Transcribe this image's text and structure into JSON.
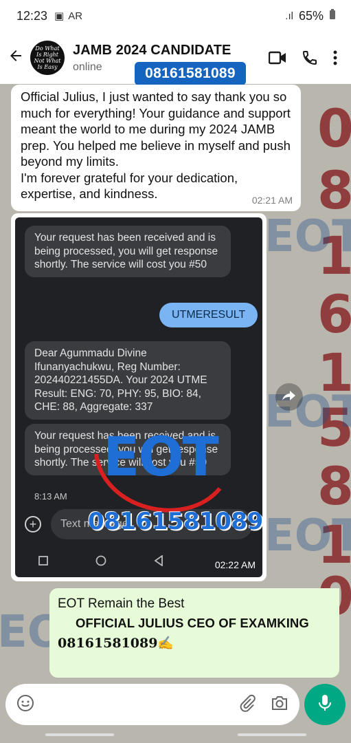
{
  "status_bar": {
    "time": "12:23",
    "battery": "65%"
  },
  "header": {
    "title": "JAMB 2024 CANDIDATE",
    "subtitle": "online",
    "avatar_text": "Do What Is Right Not What Is Easy"
  },
  "banner_phone": "08161581089",
  "messages": {
    "incoming": {
      "text": "Official Julius, I just wanted to say thank you so much for everything! Your guidance and support meant the world to me during my 2024 JAMB prep. You helped me believe in myself and push beyond my limits.\nI'm forever grateful for your dedication, expertise, and kindness.",
      "time": "02:21 AM"
    },
    "screenshot": {
      "sms1": "Your request has been received and is being processed, you will get response shortly. The service will cost you #50",
      "reply": "UTMERESULT",
      "sms2": "Dear Agummadu Divine Ifunanyachukwu, Reg Number: 202440221455DA. Your 2024 UTME Result: ENG: 70, PHY: 95, BIO: 84, CHE: 88, Aggregate: 337",
      "sms3": "Your request has been received and is being processed, you will get response shortly. The service will cost you #50",
      "sms3_time": "8:13 AM",
      "input_placeholder": "Text message",
      "time": "02:22 AM"
    },
    "watermark": {
      "brand": "EOT",
      "phone": "08161581089"
    },
    "outgoing": {
      "line1": "EOT  Remain the Best",
      "line2": "OFFICIAL JULIUS CEO OF EXAMKING",
      "line3": "08161581089✍️"
    }
  },
  "background": {
    "digits": [
      "0",
      "8",
      "1",
      "6",
      "1",
      "5",
      "8",
      "1",
      "0"
    ],
    "eot_text": "EOT"
  }
}
